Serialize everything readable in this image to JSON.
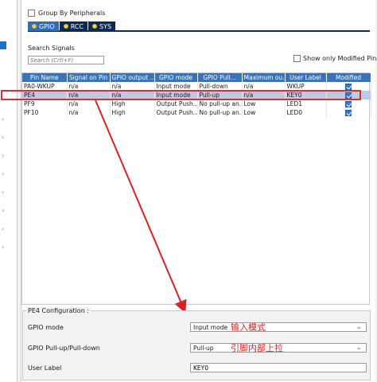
{
  "group_by": {
    "label": "Group By Peripherals",
    "checked": false
  },
  "tabs": [
    {
      "label": "GPIO",
      "active": true
    },
    {
      "label": "RCC",
      "active": false
    },
    {
      "label": "SYS",
      "active": false
    }
  ],
  "search": {
    "title": "Search Signals",
    "placeholder": "Search (Crtl+F)"
  },
  "show_modified": {
    "label": "Show only Modified Pins",
    "checked": false
  },
  "table": {
    "headers": [
      "Pin Name",
      "Signal on Pin",
      "GPIO output ...",
      "GPIO mode",
      "GPIO Pull...",
      "Maximum ou...",
      "User Label",
      "Modified"
    ],
    "rows": [
      {
        "cells": [
          "PA0-WKUP",
          "n/a",
          "n/a",
          "Input mode",
          "Pull-down",
          "n/a",
          "WKUP"
        ],
        "modified": true,
        "selected": false
      },
      {
        "cells": [
          "PE4",
          "n/a",
          "n/a",
          "Input mode",
          "Pull-up",
          "n/a",
          "KEY0"
        ],
        "modified": true,
        "selected": true
      },
      {
        "cells": [
          "PF9",
          "n/a",
          "High",
          "Output Push...",
          "No pull-up an...",
          "Low",
          "LED1"
        ],
        "modified": true,
        "selected": false
      },
      {
        "cells": [
          "PF10",
          "n/a",
          "High",
          "Output Push...",
          "No pull-up an...",
          "Low",
          "LED0"
        ],
        "modified": true,
        "selected": false
      }
    ]
  },
  "config": {
    "title": "PE4 Configuration :",
    "gpio_mode_label": "GPIO mode",
    "gpio_mode_value": "Input mode",
    "gpio_mode_annotation": "输入模式",
    "pull_label": "GPIO Pull-up/Pull-down",
    "pull_value": "Pull-up",
    "pull_annotation": "引脚内部上拉",
    "user_label_label": "User Label",
    "user_label_value": "KEY0"
  },
  "colors": {
    "tab_bar": "#0b2a55",
    "tab_active": "#2e6cbf",
    "table_header": "#3b73b9",
    "selected_row": "#b9cbe6",
    "annotation_red": "#d93030"
  }
}
